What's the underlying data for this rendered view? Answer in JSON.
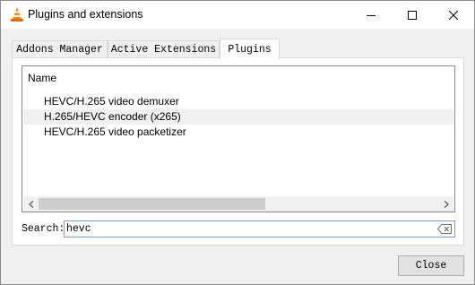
{
  "window": {
    "title": "Plugins and extensions",
    "app_icon": "vlc-cone-icon"
  },
  "tabs": [
    {
      "label": "Addons Manager",
      "active": false
    },
    {
      "label": "Active Extensions",
      "active": false
    },
    {
      "label": "Plugins",
      "active": true
    }
  ],
  "plugins": {
    "column_header": "Name",
    "rows": [
      {
        "name": "HEVC/H.265 video demuxer",
        "highlighted": false
      },
      {
        "name": "H.265/HEVC encoder (x265)",
        "highlighted": true
      },
      {
        "name": "HEVC/H.265 video packetizer",
        "highlighted": false
      }
    ]
  },
  "search": {
    "label": "Search:",
    "value": "hevc"
  },
  "buttons": {
    "close": "Close"
  },
  "colors": {
    "accent_border": "#7a9cc7",
    "vlc_orange": "#f28c00"
  }
}
